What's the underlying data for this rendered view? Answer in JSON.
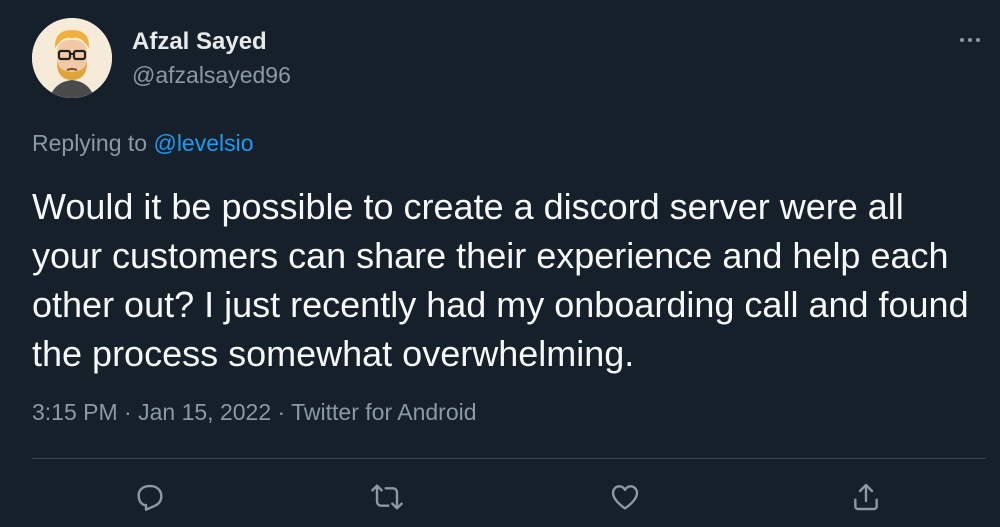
{
  "author": {
    "display_name": "Afzal Sayed",
    "handle": "@afzalsayed96"
  },
  "reply_context": {
    "prefix": "Replying to",
    "mention": "@levelsio"
  },
  "tweet": {
    "text": "Would it be possible to create a discord server were all your customers can share their experience and help each other out? I just recently had my onboarding call and found the process somewhat overwhelming.",
    "time": "3:15 PM",
    "separator": " · ",
    "date": "Jan 15, 2022",
    "source": "Twitter for Android"
  },
  "icons": {
    "more": "more-horizontal-icon",
    "reply": "reply-icon",
    "retweet": "retweet-icon",
    "like": "heart-icon",
    "share": "share-icon"
  },
  "colors": {
    "background": "#15202b",
    "text_primary": "#e7e9ea",
    "text_secondary": "#8b98a5",
    "link": "#1d9bf0",
    "divider": "#38444d"
  }
}
